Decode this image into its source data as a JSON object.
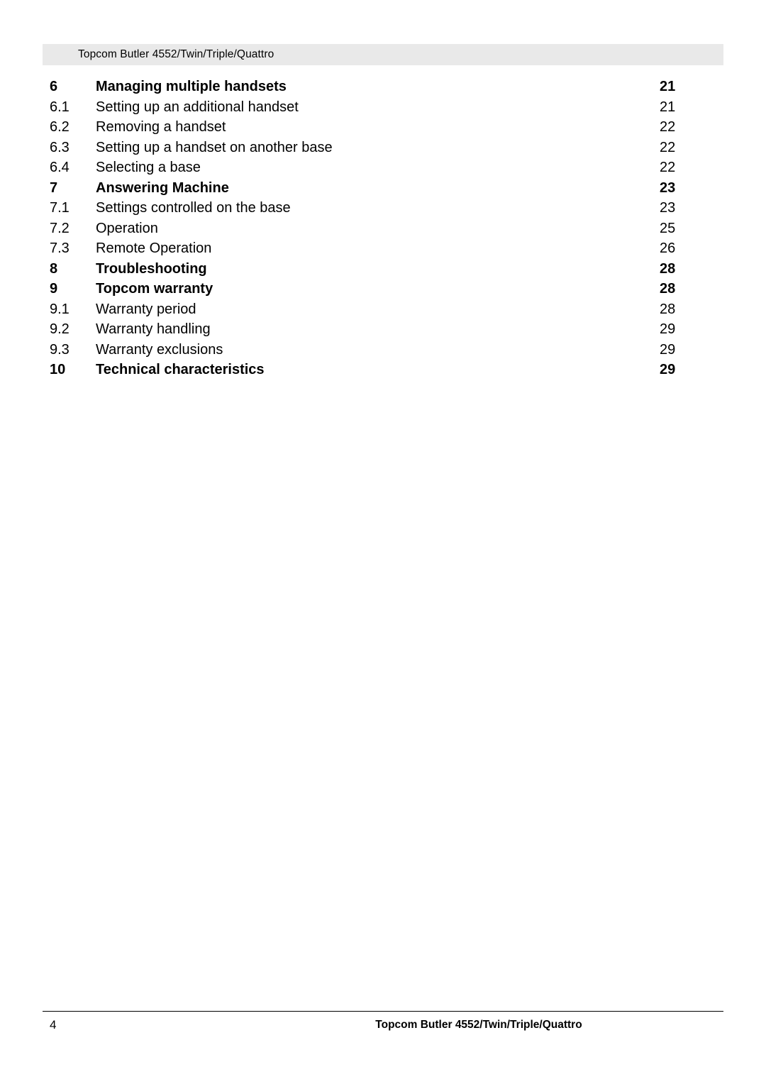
{
  "header": {
    "text": "Topcom Butler 4552/Twin/Triple/Quattro"
  },
  "toc": {
    "rows": [
      {
        "num": "6",
        "title": "Managing multiple handsets",
        "page": "21",
        "level": 1
      },
      {
        "num": "6.1",
        "title": "Setting up an additional handset",
        "page": "21",
        "level": 2
      },
      {
        "num": "6.2",
        "title": "Removing a handset",
        "page": "22",
        "level": 2
      },
      {
        "num": "6.3",
        "title": "Setting up a handset on another base",
        "page": "22",
        "level": 2
      },
      {
        "num": "6.4",
        "title": "Selecting a base",
        "page": "22",
        "level": 2
      },
      {
        "num": "7",
        "title": "Answering Machine",
        "page": "23",
        "level": 1
      },
      {
        "num": "7.1",
        "title": "Settings controlled on the base",
        "page": "23",
        "level": 2
      },
      {
        "num": "7.2",
        "title": "Operation",
        "page": "25",
        "level": 2
      },
      {
        "num": "7.3",
        "title": "Remote Operation",
        "page": "26",
        "level": 2
      },
      {
        "num": "8",
        "title": "Troubleshooting",
        "page": "28",
        "level": 1
      },
      {
        "num": "9",
        "title": "Topcom warranty",
        "page": "28",
        "level": 1
      },
      {
        "num": "9.1",
        "title": "Warranty period",
        "page": "28",
        "level": 2
      },
      {
        "num": "9.2",
        "title": "Warranty handling",
        "page": "29",
        "level": 2
      },
      {
        "num": "9.3",
        "title": "Warranty exclusions",
        "page": "29",
        "level": 2
      },
      {
        "num": "10",
        "title": "Technical characteristics",
        "page": "29",
        "level": 1
      }
    ]
  },
  "footer": {
    "page_number": "4",
    "text": "Topcom Butler 4552/Twin/Triple/Quattro"
  }
}
